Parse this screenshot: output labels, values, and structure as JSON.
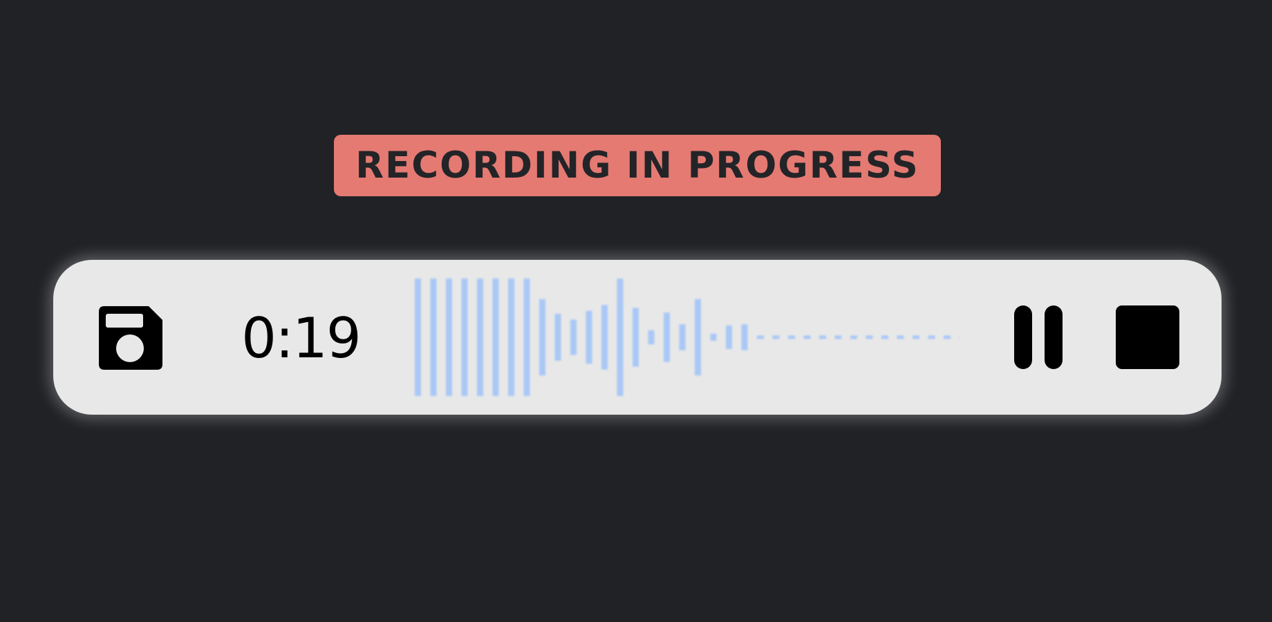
{
  "status": {
    "label": "RECORDING IN PROGRESS",
    "color": "#e47a72"
  },
  "recorder": {
    "elapsed_time": "0:19",
    "save_icon": "floppy-disk-icon",
    "pause_icon": "pause-icon",
    "stop_icon": "stop-icon",
    "waveform_color": "#a9c8f6",
    "waveform": {
      "recorded_levels": [
        1.0,
        1.0,
        1.0,
        1.0,
        1.0,
        1.0,
        1.0,
        1.0,
        0.65,
        0.4,
        0.3,
        0.45,
        0.55,
        1.0,
        0.5,
        0.12,
        0.42,
        0.22,
        0.65,
        0.06,
        0.2,
        0.22
      ],
      "pending_ticks": 15
    }
  }
}
